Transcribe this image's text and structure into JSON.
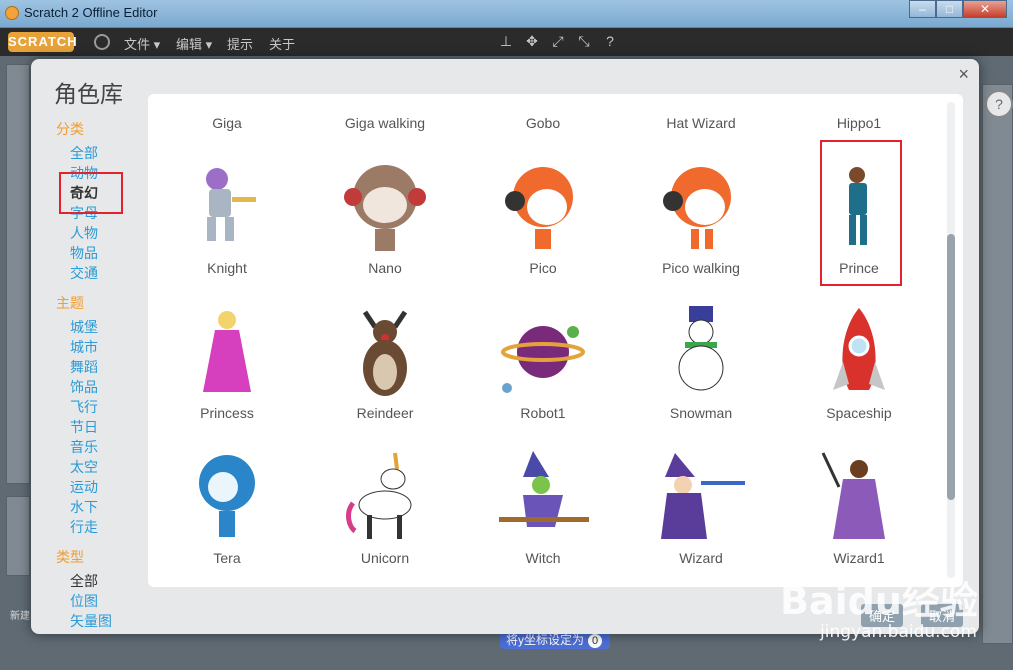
{
  "window": {
    "title": "Scratch 2 Offline Editor",
    "min": "–",
    "max": "□",
    "close": "✕"
  },
  "menubar": {
    "logo": "SCRATCH",
    "file": "文件 ▾",
    "edit": "编辑 ▾",
    "tips": "提示",
    "about": "关于"
  },
  "dialog": {
    "title": "角色库",
    "close": "×",
    "category": {
      "heading": "分类",
      "items": [
        "全部",
        "动物",
        "奇幻",
        "字母",
        "人物",
        "物品",
        "交通"
      ],
      "selected": "奇幻"
    },
    "theme": {
      "heading": "主题",
      "items": [
        "城堡",
        "城市",
        "舞蹈",
        "饰品",
        "飞行",
        "节日",
        "音乐",
        "太空",
        "运动",
        "水下",
        "行走"
      ]
    },
    "type": {
      "heading": "类型",
      "items": [
        "全部",
        "位图",
        "矢量图"
      ],
      "selected": "全部"
    },
    "top_row": [
      "Giga",
      "Giga walking",
      "Gobo",
      "Hat Wizard",
      "Hippo1"
    ],
    "sprites": [
      [
        "Knight",
        "Nano",
        "Pico",
        "Pico walking",
        "Prince"
      ],
      [
        "Princess",
        "Reindeer",
        "Robot1",
        "Snowman",
        "Spaceship"
      ],
      [
        "Tera",
        "Unicorn",
        "Witch",
        "Wizard",
        "Wizard1"
      ]
    ],
    "ok_button": "确定",
    "cancel_button": "取消"
  },
  "background": {
    "new_sprite": "新建",
    "block_text": "将y坐标设定为",
    "block_value": "0",
    "help": "?"
  },
  "watermark": {
    "line1": "Baidu经验",
    "line2": "jingyan.baidu.com"
  },
  "colors": {
    "category_heading": "#f39d2f",
    "link": "#2a9bd6",
    "highlight": "#e0242f",
    "accent": "#e7a23a"
  }
}
